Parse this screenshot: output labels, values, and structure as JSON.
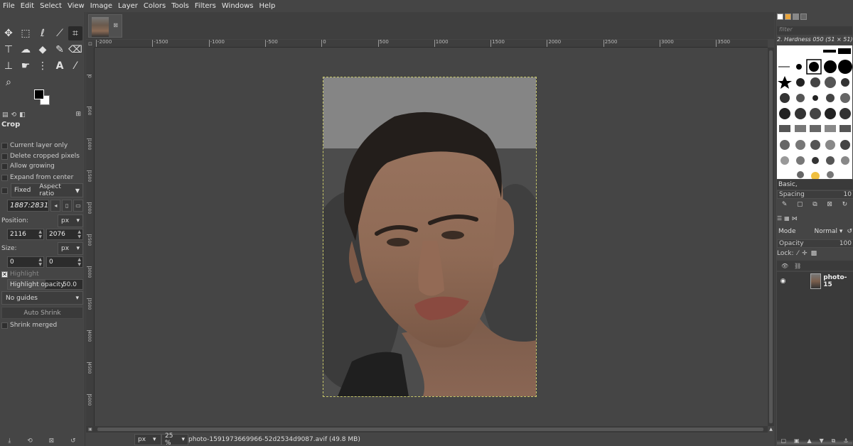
{
  "menu": [
    "File",
    "Edit",
    "Select",
    "View",
    "Image",
    "Layer",
    "Colors",
    "Tools",
    "Filters",
    "Windows",
    "Help"
  ],
  "toolbox": {
    "tools": [
      "move-tool",
      "rect-select-tool",
      "free-select-tool",
      "fuzzy-select-tool",
      "crop-tool",
      "transform-tool",
      "warp-tool",
      "bucket-fill-tool",
      "paintbrush-tool",
      "eraser-tool",
      "clone-tool",
      "smudge-tool",
      "paths-tool",
      "text-tool",
      "color-picker-tool",
      "zoom-tool"
    ],
    "active_tool": "crop-tool"
  },
  "tool_options": {
    "title": "Crop",
    "current_layer_only": "Current layer only",
    "delete_cropped_pixels": "Delete cropped pixels",
    "allow_growing": "Allow growing",
    "expand_from_center": "Expand from center",
    "fixed_label": "Fixed",
    "aspect_ratio": "Aspect ratio",
    "ratio_value": "1887:2831",
    "position_label": "Position:",
    "position_unit": "px",
    "position_x": "2116",
    "position_y": "2076",
    "size_label": "Size:",
    "size_unit": "px",
    "size_w": "0",
    "size_h": "0",
    "highlight_label": "Highlight",
    "highlight_opacity_label": "Highlight opacity",
    "highlight_opacity_value": "50.0",
    "highlight_opacity_fraction": 0.5,
    "guides": "No guides",
    "auto_shrink": "Auto Shrink",
    "shrink_merged": "Shrink merged"
  },
  "rulers": {
    "top": [
      "-2000",
      "-1500",
      "-1000",
      "-500",
      "0",
      "500",
      "1000",
      "1500",
      "2000",
      "2500",
      "3000",
      "3500"
    ],
    "left": [
      "0",
      "500",
      "1000",
      "1500",
      "2000",
      "2500",
      "3000",
      "3500",
      "4000",
      "4500",
      "5000",
      "5500"
    ]
  },
  "statusbar": {
    "unit": "px",
    "zoom": "25 %",
    "filename": "photo-1591973669966-52d2534d9087.avif (49.8 MB)"
  },
  "dock": {
    "filter_placeholder": "filter",
    "brush_name": "2. Hardness 050 (51 × 51)",
    "brush_tag": "Basic,",
    "spacing_label": "Spacing",
    "spacing_value": "10",
    "mode_label": "Mode",
    "mode_value": "Normal",
    "opacity_label": "Opacity",
    "opacity_value": "100",
    "lock_label": "Lock:",
    "layer_name": "photo-15"
  }
}
